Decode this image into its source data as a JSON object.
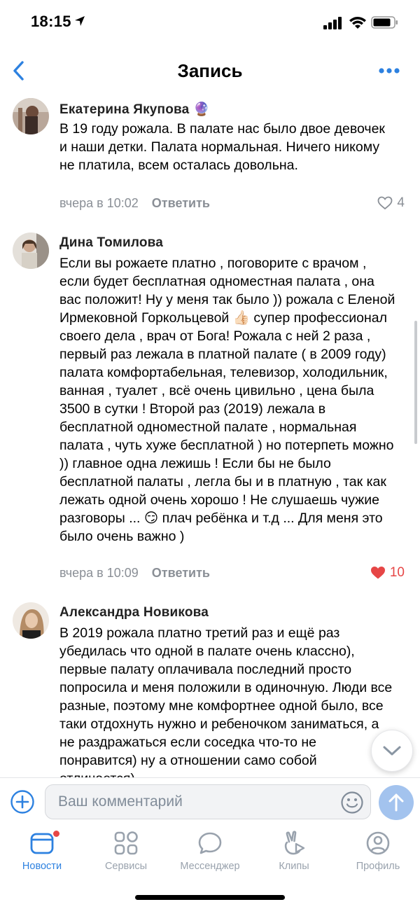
{
  "status_bar": {
    "time": "18:15"
  },
  "header": {
    "title": "Запись"
  },
  "comments": [
    {
      "author": "Екатерина Якупова",
      "author_emoji": "🔮",
      "text": "В 19 году рожала. В палате нас было двое девочек и наши детки. Палата нормальная. Ничего никому не платила, всем осталась довольна.",
      "time": "вчера в 10:02",
      "reply_label": "Ответить",
      "likes": "4",
      "liked": false
    },
    {
      "author": "Дина Томилова",
      "author_emoji": "",
      "text": "Если вы рожаете платно , поговорите с врачом , если будет бесплатная одноместная палата , она вас положит! Ну у меня так было )) рожала с Еленой Ирмековной Горкольцевой 👍🏻 супер профессионал своего дела , врач от Бога! Рожала с ней 2 раза , первый раз лежала в платной палате ( в 2009 году) палата комфортабельная, телевизор, холодильник, ванная , туалет , всё очень цивильно , цена была 3500 в сутки ! Второй раз (2019) лежала в бесплатной одноместной палате , нормальная палата , чуть хуже бесплатной ) но потерпеть можно )) главное одна лежишь ! Если бы не было бесплатной палаты , легла бы и в платную , так как лежать одной очень хорошо ! Не слушаешь чужие разговоры ... 😏 плач ребёнка и т.д ... Для меня это было очень важно )",
      "time": "вчера в 10:09",
      "reply_label": "Ответить",
      "likes": "10",
      "liked": true
    },
    {
      "author": "Александра Новикова",
      "author_emoji": "",
      "text": "В 2019 рожала платно третий раз и ещё раз убедилась что одной в палате очень классно), первые палату оплачивала последний просто попросила и меня положили в одиночную. Люди все разные, поэтому мне комфортнее одной было, все таки отдохнуть нужно и ребеночком заниматься, а не раздражаться если соседка что-то не понравится) ну а отношении само собой отличается)",
      "time": "",
      "reply_label": "",
      "likes": "",
      "liked": false
    }
  ],
  "composer": {
    "placeholder": "Ваш комментарий"
  },
  "tabs": [
    {
      "label": "Новости",
      "icon": "news-icon",
      "active": true
    },
    {
      "label": "Сервисы",
      "icon": "services-icon",
      "active": false
    },
    {
      "label": "Мессенджер",
      "icon": "messenger-icon",
      "active": false
    },
    {
      "label": "Клипы",
      "icon": "clips-icon",
      "active": false
    },
    {
      "label": "Профиль",
      "icon": "profile-icon",
      "active": false
    }
  ],
  "colors": {
    "accent": "#2d81e0",
    "like_active": "#e64646",
    "meta_gray": "#8a8f96",
    "send_button": "#a3c3ee"
  }
}
